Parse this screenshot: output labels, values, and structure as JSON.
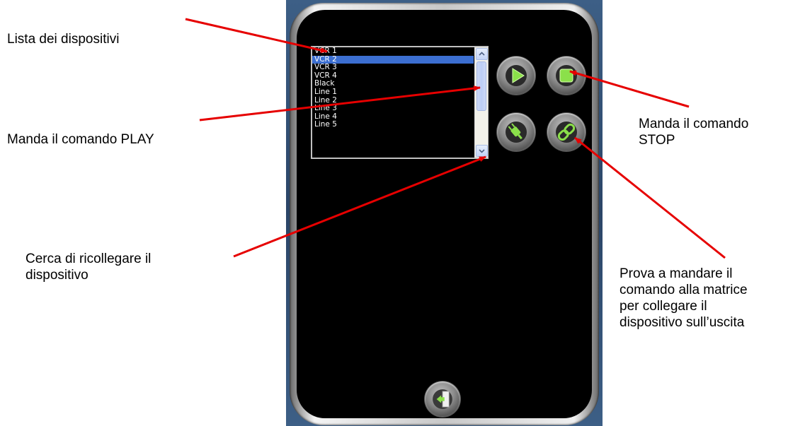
{
  "annotations": {
    "device_list": "Lista dei dispositivi",
    "play": "Manda il comando PLAY",
    "reconnect": [
      "Cerca di ricollegare il",
      "dispositivo"
    ],
    "stop": [
      "Manda il comando",
      "STOP"
    ],
    "matrix": [
      "Prova a mandare il",
      "comando alla matrice",
      "per collegare il",
      "dispositivo sull’uscita"
    ]
  },
  "device_list": {
    "items": [
      "VCR 1",
      "VCR 2",
      "VCR 3",
      "VCR 4",
      "Black",
      "Line 1",
      "Line 2",
      "Line 3",
      "Line 4",
      "Line 5"
    ],
    "selected": "VCR 2"
  },
  "buttons": {
    "play": "play-icon",
    "stop": "stop-icon",
    "reconnect": "plug-icon",
    "matrix": "link-icon",
    "exit": "exit-door-icon"
  },
  "colors": {
    "arrow": "#e60000",
    "selection": "#3c6fd1",
    "screen": "#000000",
    "button_green": "#8be04a"
  }
}
